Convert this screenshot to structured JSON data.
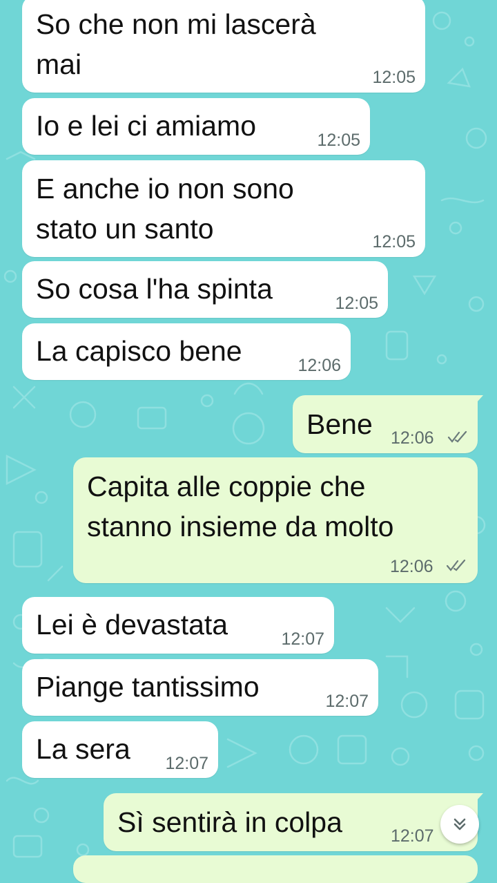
{
  "colors": {
    "wallpaper": "#70d6d6",
    "incoming_bubble": "#ffffff",
    "outgoing_bubble": "#e8fbd4",
    "timestamp": "#5c6b6b",
    "read_ticks": "#6b7b7b"
  },
  "messages": [
    {
      "direction": "incoming",
      "lines": [
        "So che non mi lascerà",
        "mai"
      ],
      "time": "12:05"
    },
    {
      "direction": "incoming",
      "lines": [
        "Io e lei ci amiamo"
      ],
      "time": "12:05"
    },
    {
      "direction": "incoming",
      "lines": [
        "E anche io non sono",
        "stato un santo"
      ],
      "time": "12:05"
    },
    {
      "direction": "incoming",
      "lines": [
        "So cosa l'ha spinta"
      ],
      "time": "12:05"
    },
    {
      "direction": "incoming",
      "lines": [
        "La capisco bene"
      ],
      "time": "12:06"
    },
    {
      "direction": "outgoing",
      "lines": [
        "Bene"
      ],
      "time": "12:06",
      "status": "read"
    },
    {
      "direction": "outgoing",
      "lines": [
        "Capita alle coppie che",
        "stanno insieme da molto"
      ],
      "time": "12:06",
      "status": "read"
    },
    {
      "direction": "incoming",
      "lines": [
        "Lei è devastata"
      ],
      "time": "12:07"
    },
    {
      "direction": "incoming",
      "lines": [
        "Piange tantissimo"
      ],
      "time": "12:07"
    },
    {
      "direction": "incoming",
      "lines": [
        "La sera"
      ],
      "time": "12:07"
    },
    {
      "direction": "outgoing",
      "lines": [
        "Sì sentirà in colpa"
      ],
      "time": "12:07",
      "status": "read"
    }
  ],
  "scroll_button": {
    "icon": "double-chevron-down-icon"
  }
}
